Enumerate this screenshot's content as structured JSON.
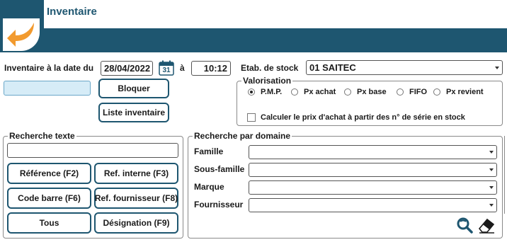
{
  "window": {
    "title": "Inventaire"
  },
  "inventory": {
    "date_label": "Inventaire à la date du",
    "date_value": "28/04/2022",
    "calendar_day": "31",
    "a_label": "à",
    "time_value": "10:12",
    "block_button": "Bloquer",
    "list_button": "Liste inventaire"
  },
  "stock": {
    "label": "Etab. de stock",
    "selected": "01 SAITEC"
  },
  "valorisation": {
    "title": "Valorisation",
    "options": [
      {
        "label": "P.M.P.",
        "selected": true
      },
      {
        "label": "Px achat",
        "selected": false
      },
      {
        "label": "Px base",
        "selected": false
      },
      {
        "label": "FIFO",
        "selected": false
      },
      {
        "label": "Px revient",
        "selected": false
      }
    ],
    "serial_checkbox_label": "Calculer le prix d'achat à partir des n° de série en stock",
    "serial_checked": false
  },
  "text_search": {
    "title": "Recherche texte",
    "value": "",
    "buttons": {
      "reference": "Référence (F2)",
      "internal_ref": "Ref. interne (F3)",
      "barcode": "Code barre (F6)",
      "supplier_ref": "Ref. fournisseur (F8)",
      "all": "Tous",
      "designation": "Désignation (F9)"
    }
  },
  "domain_search": {
    "title": "Recherche par domaine",
    "fields": [
      {
        "label": "Famille",
        "value": ""
      },
      {
        "label": "Sous-famille",
        "value": ""
      },
      {
        "label": "Marque",
        "value": ""
      },
      {
        "label": "Fournisseur",
        "value": ""
      }
    ]
  },
  "colors": {
    "primary": "#1e5670",
    "accent": "#f29a2e",
    "input_highlight": "#d6ecf7"
  }
}
